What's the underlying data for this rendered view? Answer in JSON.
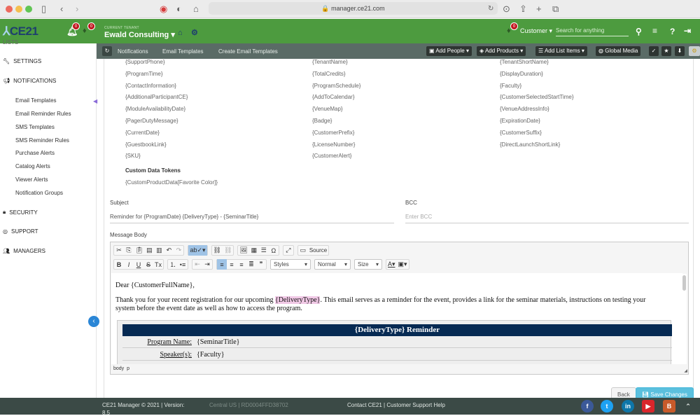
{
  "browser": {
    "url": "manager.ce21.com"
  },
  "header": {
    "logo": "CE21",
    "notif_badge_1": "0",
    "notif_badge_2": "0",
    "tenant_caption": "CURRENT TENANT",
    "tenant_name": "Ewald Consulting",
    "cart_badge": "0",
    "customer_select": "Customer",
    "search_placeholder": "Search for anything"
  },
  "sidebar": {
    "partial_top": "LISTS",
    "sections": [
      {
        "label": "SETTINGS",
        "icon": "wrench-icon"
      },
      {
        "label": "NOTIFICATIONS",
        "icon": "megaphone-icon"
      },
      {
        "label": "SECURITY",
        "icon": "lock-icon"
      },
      {
        "label": "SUPPORT",
        "icon": "lifebuoy-icon"
      },
      {
        "label": "MANAGERS",
        "icon": "users-icon"
      }
    ],
    "sub_items": [
      "Email Templates",
      "Email Reminder Rules",
      "SMS Templates",
      "SMS Reminder Rules",
      "Purchase Alerts",
      "Catalog Alerts",
      "Viewer Alerts",
      "Notification Groups"
    ]
  },
  "subbar": {
    "crumbs": [
      "Notifications",
      "Email Templates",
      "Create Email Templates"
    ],
    "buttons": [
      "Add People",
      "Add Products",
      "Add List Items",
      "Global Media"
    ]
  },
  "tokens": {
    "col1": [
      "{SupportPhone}",
      "{ProgramTime}",
      "{ContactInformation}",
      "{AdditionalParticipantCE}",
      "{ModuleAvailabilityDate}",
      "{PagerDutyMessage}",
      "{CurrentDate}",
      "{GuestbookLink}",
      "{SKU}"
    ],
    "col2": [
      "{TenantName}",
      "{TotalCredits}",
      "{ProgramSchedule}",
      "{AddToCalendar}",
      "{VenueMap}",
      "{Badge}",
      "{CustomerPrefix}",
      "{LicenseNumber}",
      "{CustomerAlert}"
    ],
    "col3": [
      "{TenantShortName}",
      "{DisplayDuration}",
      "{Faculty}",
      "{CustomerSelectedStartTime}",
      "{VenueAddressInfo}",
      "{ExpirationDate}",
      "{CustomerSuffix}",
      "{DirectLaunchShortLink}"
    ],
    "custom_heading": "Custom Data Tokens",
    "custom_tokens": [
      "{CustomProductData[Favorite Color]}"
    ]
  },
  "form": {
    "subject_label": "Subject",
    "subject_value": "Reminder for {ProgramDate} {DeliveryType} - {SeminarTitle}",
    "bcc_label": "BCC",
    "bcc_placeholder": "Enter BCC",
    "body_label": "Message Body"
  },
  "editor": {
    "source_label": "Source",
    "styles_label": "Styles",
    "format_label": "Normal",
    "size_label": "Size",
    "greeting": "Dear {CustomerFullName},",
    "para_before": "Thank you for your recent registration for our upcoming ",
    "para_token": "{DeliveryType}",
    "para_after": ". This email serves as a reminder for the event, provides a link for the seminar materials, instructions on testing your",
    "para_line2": "system before the event date as well as how to access the program.",
    "table_title": "{DeliveryType} Reminder",
    "rows": [
      {
        "key": "Program Name:",
        "value": "{SeminarTitle}"
      },
      {
        "key": "Speaker(s):",
        "value": "{Faculty}"
      }
    ],
    "path": [
      "body",
      "p"
    ]
  },
  "actions": {
    "back": "Back",
    "save": "Save Changes"
  },
  "footer": {
    "copyright": "CE21 Manager © 2021 | Version:",
    "version": "8.5",
    "timezone": "Central US | RD0004FFD38702",
    "links": "Contact CE21 | Customer Support Help"
  }
}
